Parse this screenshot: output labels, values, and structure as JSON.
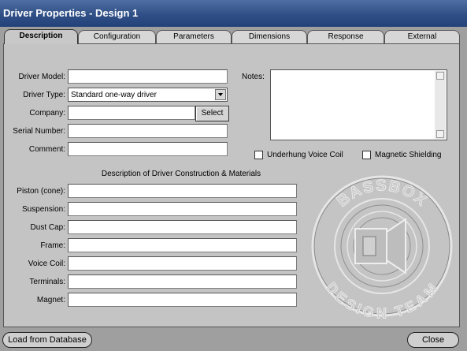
{
  "window": {
    "title": "Driver Properties - Design 1"
  },
  "tabs": [
    {
      "label": "Description",
      "active": true
    },
    {
      "label": "Configuration"
    },
    {
      "label": "Parameters"
    },
    {
      "label": "Dimensions"
    },
    {
      "label": "Response"
    },
    {
      "label": "External"
    }
  ],
  "fields": {
    "driver_model": {
      "label": "Driver Model:",
      "value": ""
    },
    "driver_type": {
      "label": "Driver Type:",
      "value": "Standard one-way driver"
    },
    "company": {
      "label": "Company:",
      "value": "",
      "button": "Select"
    },
    "serial_number": {
      "label": "Serial Number:",
      "value": ""
    },
    "comment": {
      "label": "Comment:",
      "value": ""
    },
    "notes": {
      "label": "Notes:",
      "value": ""
    }
  },
  "checkboxes": {
    "underhung": {
      "label": "Underhung Voice Coil",
      "checked": false
    },
    "magnetic": {
      "label": "Magnetic Shielding",
      "checked": false
    }
  },
  "construction": {
    "heading": "Description of Driver Construction & Materials",
    "piston": {
      "label": "Piston (cone):",
      "value": ""
    },
    "suspension": {
      "label": "Suspension:",
      "value": ""
    },
    "dust_cap": {
      "label": "Dust Cap:",
      "value": ""
    },
    "frame": {
      "label": "Frame:",
      "value": ""
    },
    "voice_coil": {
      "label": "Voice Coil:",
      "value": ""
    },
    "terminals": {
      "label": "Terminals:",
      "value": ""
    },
    "magnet": {
      "label": "Magnet:",
      "value": ""
    }
  },
  "logo": {
    "top_text": "BASSBOX",
    "bottom_text": "DESIGN TEAM"
  },
  "footer": {
    "load_label": "Load from Database",
    "close_label": "Close"
  }
}
